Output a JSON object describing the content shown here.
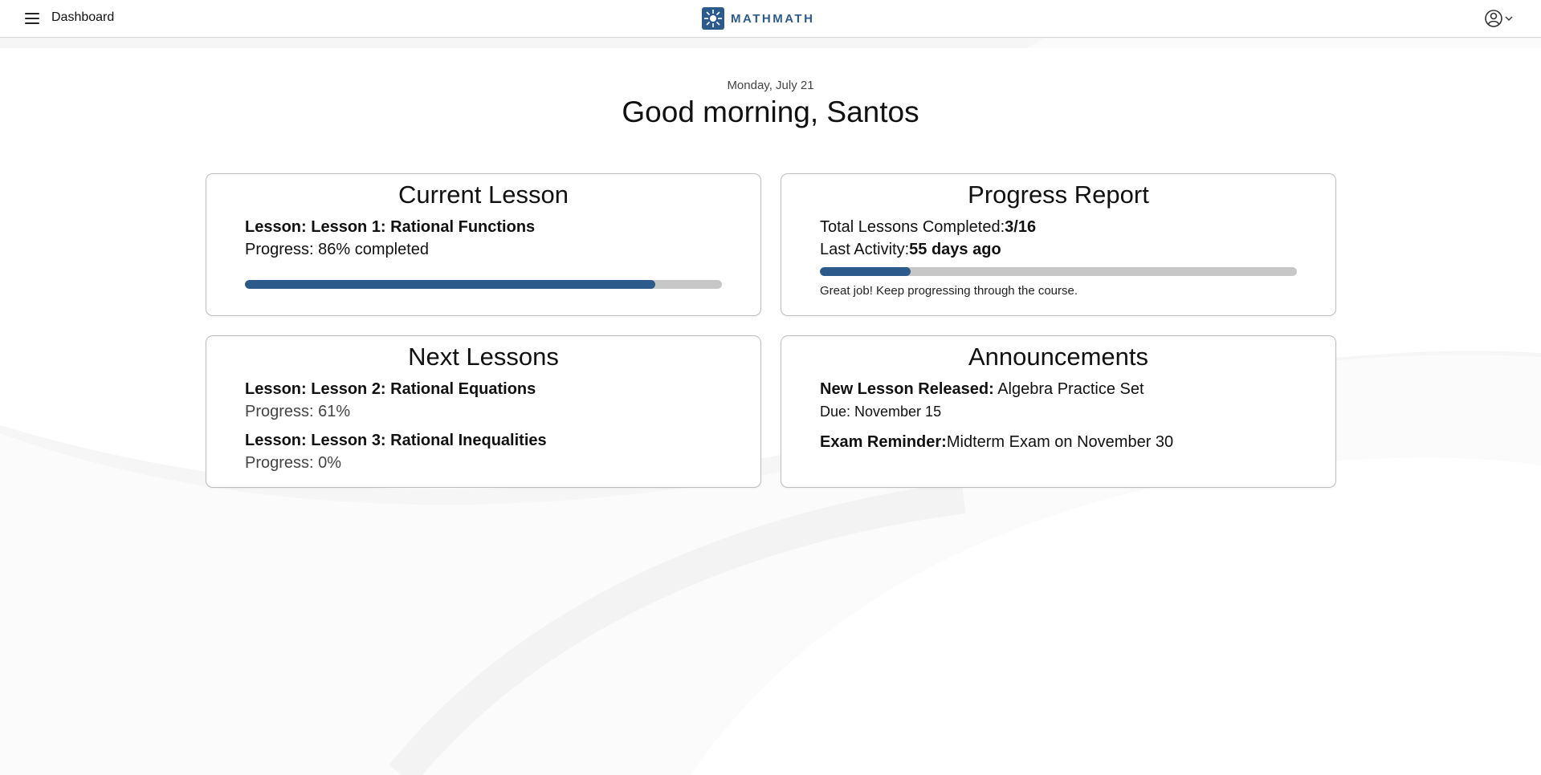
{
  "header": {
    "breadcrumb": "Dashboard",
    "brand": "MATHMATH",
    "menu_icon": "hamburger-menu-icon",
    "user_icon": "user-circle-icon"
  },
  "welcome": {
    "date": "Monday, July 21",
    "greeting": "Good morning, Santos"
  },
  "current_lesson": {
    "title": "Current Lesson",
    "lesson_label": "Lesson: Lesson 1:  Rational Functions",
    "progress_label": "Progress: 86% completed",
    "progress": 0.86
  },
  "progress_report": {
    "title": "Progress Report",
    "completed_label": "Total Lessons Completed:",
    "completed_value": "3/16",
    "activity_label": "Last Activity:",
    "activity_value": "55 days ago",
    "progress": 0.19,
    "message": "Great job! Keep progressing through the course."
  },
  "next_lessons": {
    "title": "Next Lessons",
    "items": [
      {
        "lesson": "Lesson: Lesson 2: Rational Equations",
        "progress": "Progress: 61%"
      },
      {
        "lesson": "Lesson: Lesson 3: Rational Inequalities",
        "progress": "Progress: 0%"
      }
    ]
  },
  "announcements": {
    "title": "Announcements",
    "items": [
      {
        "label": "New Lesson Released:",
        "text": " Algebra Practice Set",
        "due": "Due: November 15"
      },
      {
        "label": "Exam Reminder:",
        "text": "Midterm Exam on November 30"
      }
    ]
  },
  "colors": {
    "accent": "#2c5a8a",
    "track": "#c7c7c7"
  }
}
